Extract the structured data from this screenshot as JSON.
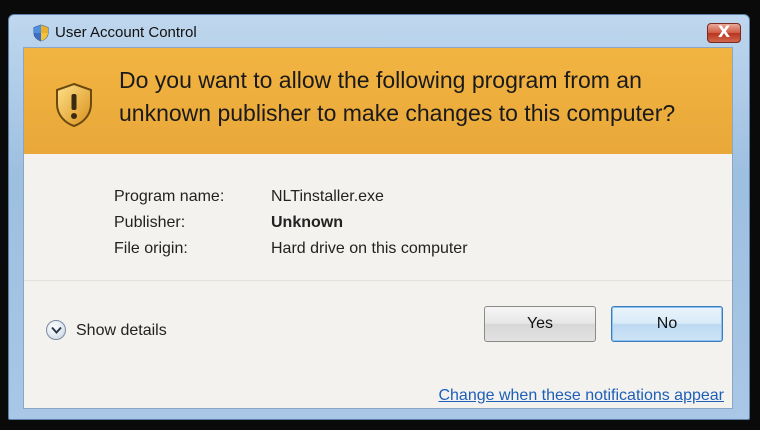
{
  "window": {
    "title": "User Account Control",
    "title_icon": "uac-shield-icon",
    "close_label": "X"
  },
  "banner": {
    "icon": "warning-shield-icon",
    "message": "Do you want to allow the following program from an unknown publisher to make changes to this computer?"
  },
  "program_info": {
    "rows": [
      {
        "label": "Program name:",
        "value": "NLTinstaller.exe",
        "bold": false
      },
      {
        "label": "Publisher:",
        "value": "Unknown",
        "bold": true
      },
      {
        "label": "File origin:",
        "value": "Hard drive on this computer",
        "bold": false
      }
    ]
  },
  "details": {
    "label": "Show details",
    "icon": "chevron-down-icon"
  },
  "buttons": {
    "yes_label": "Yes",
    "no_label": "No"
  },
  "footer": {
    "link_text": "Change when these notifications appear"
  },
  "colors": {
    "banner": "#e9a83a",
    "link": "#1d5fb8",
    "close_button": "#c94a33"
  }
}
